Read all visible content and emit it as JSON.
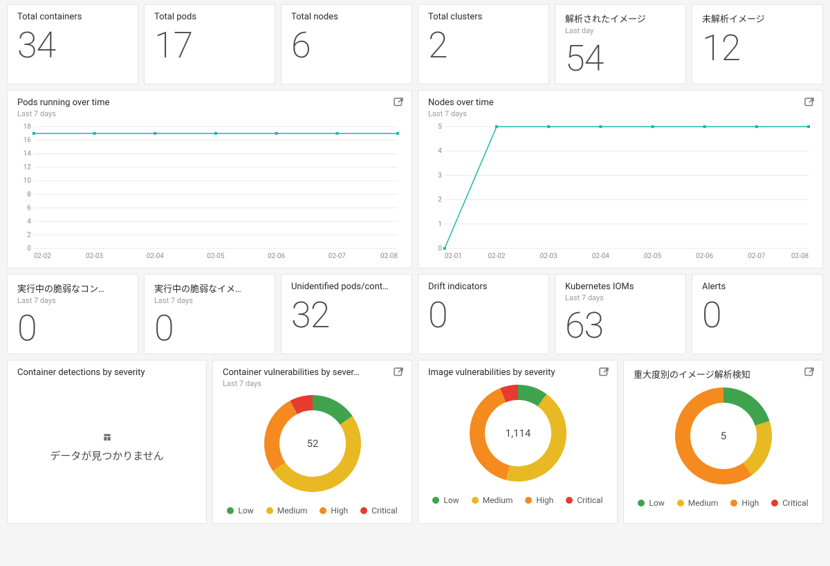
{
  "colors": {
    "low": "#3fa34d",
    "medium": "#e8b923",
    "high": "#f58a1f",
    "critical": "#e63b2e",
    "line": "#1fb5ad"
  },
  "stats_row1": [
    {
      "title": "Total containers",
      "sub": "",
      "value": "34"
    },
    {
      "title": "Total pods",
      "sub": "",
      "value": "17"
    },
    {
      "title": "Total nodes",
      "sub": "",
      "value": "6"
    },
    {
      "title": "Total clusters",
      "sub": "",
      "value": "2"
    },
    {
      "title": "解析されたイメージ",
      "sub": "Last day",
      "value": "54"
    },
    {
      "title": "未解析イメージ",
      "sub": "",
      "value": "12"
    }
  ],
  "pods_chart": {
    "title": "Pods running over time",
    "sub": "Last 7 days"
  },
  "nodes_chart": {
    "title": "Nodes over time",
    "sub": "Last 7 days"
  },
  "stats_row2": [
    {
      "title": "実行中の脆弱なコン…",
      "sub": "Last 7 days",
      "value": "0"
    },
    {
      "title": "実行中の脆弱なイメ…",
      "sub": "Last 7 days",
      "value": "0"
    },
    {
      "title": "Unidentified pods/cont…",
      "sub": "",
      "value": "32"
    },
    {
      "title": "Drift indicators",
      "sub": "",
      "value": "0"
    },
    {
      "title": "Kubernetes IOMs",
      "sub": "Last 7 days",
      "value": "63"
    },
    {
      "title": "Alerts",
      "sub": "",
      "value": "0"
    }
  ],
  "nodata_card": {
    "title": "Container detections by severity",
    "msg": "データが見つかりません"
  },
  "donut1": {
    "title": "Container vulnerabilities by sever…",
    "sub": "Last 7 days",
    "center": "52"
  },
  "donut2": {
    "title": "Image vulnerabilities by severity",
    "sub": "",
    "center": "1,114"
  },
  "donut3": {
    "title": "重大度別のイメージ解析検知",
    "sub": "",
    "center": "5"
  },
  "legend": {
    "low": "Low",
    "medium": "Medium",
    "high": "High",
    "critical": "Critical"
  },
  "chart_data": [
    {
      "name": "pods_running_over_time",
      "type": "line",
      "title": "Pods running over time",
      "xlabel": "",
      "ylabel": "",
      "ylim": [
        0,
        18
      ],
      "categories": [
        "02-02",
        "02-03",
        "02-04",
        "02-05",
        "02-06",
        "02-07",
        "02-08"
      ],
      "values": [
        17,
        17,
        17,
        17,
        17,
        17,
        17
      ],
      "y_ticks": [
        0,
        2,
        4,
        6,
        8,
        10,
        12,
        14,
        16,
        18
      ]
    },
    {
      "name": "nodes_over_time",
      "type": "line",
      "title": "Nodes over time",
      "xlabel": "",
      "ylabel": "",
      "ylim": [
        0,
        5
      ],
      "categories": [
        "02-01",
        "02-02",
        "02-03",
        "02-04",
        "02-05",
        "02-06",
        "02-07",
        "02-08"
      ],
      "values": [
        0,
        5,
        5,
        5,
        5,
        5,
        5,
        5
      ],
      "y_ticks": [
        0,
        1,
        2,
        3,
        4,
        5
      ]
    },
    {
      "name": "container_vulnerabilities_by_severity",
      "type": "donut",
      "title": "Container vulnerabilities by severity",
      "total": 52,
      "series": [
        {
          "name": "Low",
          "value": 8
        },
        {
          "name": "Medium",
          "value": 26
        },
        {
          "name": "High",
          "value": 14
        },
        {
          "name": "Critical",
          "value": 4
        }
      ]
    },
    {
      "name": "image_vulnerabilities_by_severity",
      "type": "donut",
      "title": "Image vulnerabilities by severity",
      "total": 1114,
      "series": [
        {
          "name": "Low",
          "value": 112
        },
        {
          "name": "Medium",
          "value": 490
        },
        {
          "name": "High",
          "value": 445
        },
        {
          "name": "Critical",
          "value": 67
        }
      ]
    },
    {
      "name": "image_analysis_detections_by_severity",
      "type": "donut",
      "title": "重大度別のイメージ解析検知",
      "total": 5,
      "series": [
        {
          "name": "Low",
          "value": 1
        },
        {
          "name": "Medium",
          "value": 1
        },
        {
          "name": "High",
          "value": 3
        },
        {
          "name": "Critical",
          "value": 0
        }
      ]
    }
  ]
}
